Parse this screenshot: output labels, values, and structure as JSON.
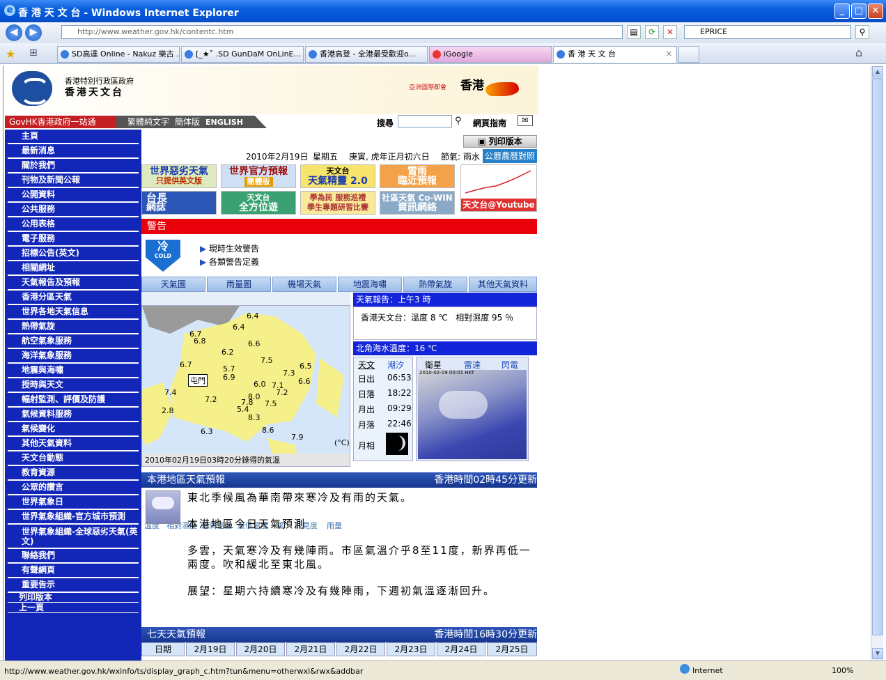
{
  "window": {
    "title": "香 港 天 文 台 - Windows Internet Explorer",
    "btn_min": "_",
    "btn_max": "□",
    "btn_close": "✕"
  },
  "address": {
    "url": "http://www.weather.gov.hk/contentc.htm",
    "search": "EPRICE"
  },
  "tabs": [
    {
      "label": "SD高達 Online - Nakuz 樂古 ..."
    },
    {
      "label": "[_★˚ .SD GunDaM OnLinE..."
    },
    {
      "label": "香港高登 - 全港最受歡迎o..."
    },
    {
      "label": "iGoogle"
    },
    {
      "label": "香 港 天 文 台"
    }
  ],
  "header": {
    "gov": "香港特別行政區政府",
    "obs": "香港天文台",
    "asia": "亞洲國際都會",
    "hk": "香港"
  },
  "govbar": {
    "govhk": "GovHK香港政府一站通",
    "trad": "繁體純文字",
    "simp": "簡体版",
    "eng": "ENGLISH",
    "search_label": "搜尋",
    "guide": "網頁指南"
  },
  "leftnav": [
    "主頁",
    "最新消息",
    "關於我們",
    "刊物及新聞公報",
    "公開資料",
    "公共服務",
    "公用表格",
    "電子服務",
    "招標公告(英文)",
    "相關網址",
    "天氣報告及預報",
    "香港分區天氣",
    "世界各地天氣信息",
    "熱帶氣旋",
    "航空氣象服務",
    "海洋氣象服務",
    "地震與海嘯",
    "授時與天文",
    "輻射監測、評價及防護",
    "氣候資料服務",
    "氣候變化",
    "其他天氣資料",
    "天文台動態",
    "教育資源",
    "公眾的讚言",
    "世界氣象日",
    "世界氣象組織-官方城市預測",
    "世界氣象組織-全球惡劣天氣(英文)",
    "聯絡我們",
    "有聲網頁",
    "重要告示",
    "列印版本",
    "上一頁"
  ],
  "dateline": {
    "date": "2010年2月19日",
    "weekday": "星期五",
    "lunar": "庚寅, 虎年正月初六日",
    "solar": "節氣: 雨水",
    "calendar": "公曆農曆對照",
    "print": "列印版本"
  },
  "banners": [
    "世界惡劣天氣",
    "只提供英文版",
    "世界官方預報",
    "簡體版",
    "天文台",
    "天氣精靈 2.0",
    "雷雨",
    "臨近預報",
    "台長",
    "網誌",
    "天文台",
    "全方位遊",
    "學為民 服務巡禮",
    "學生專題研習比賽",
    "社區天氣 Co-WIN",
    "資訊網絡",
    "天文台@Youtube"
  ],
  "warning": {
    "title": "警告",
    "cold": "冷",
    "cold_en": "COLD",
    "link1": "現時生效警告",
    "link2": "各類警告定義"
  },
  "weather_tabs": [
    "天氣圖",
    "雨量圖",
    "機場天氣",
    "地震海嘯",
    "熱帶氣旋",
    "其他天氣資料"
  ],
  "sub_tabs": [
    "溫度",
    "相對濕度",
    "最高溫度",
    "最低溫度",
    "風",
    "能見度",
    "雨量"
  ],
  "map": {
    "temps": [
      "6.4",
      "6.4",
      "6.7",
      "6.8",
      "6.6",
      "6.2",
      "7.5",
      "5.7",
      "6.5",
      "6.9",
      "6.7",
      "7.3",
      "6.0",
      "7.1",
      "6.6",
      "7.2",
      "7.4",
      "7.2",
      "8.0",
      "7.8",
      "7.5",
      "5.4",
      "2.8",
      "8.3",
      "6.3",
      "8.6",
      "7.9"
    ],
    "label": "屯門",
    "unit": "(°C)",
    "caption": "2010年02月19日03時20分錄得的氣溫"
  },
  "report": {
    "title": "天氣報告：上午3 時",
    "station": "香港天文台：",
    "temp": "溫度 8 ℃",
    "rh": "相對濕度 95 ％",
    "sea": "北角海水溫度：16 ℃"
  },
  "astro": {
    "tab1": "天文",
    "tab2": "潮汐",
    "rows": [
      [
        "日出",
        "06:53"
      ],
      [
        "日落",
        "18:22"
      ],
      [
        "月出",
        "09:29"
      ],
      [
        "月落",
        "22:46"
      ],
      [
        "月相",
        ""
      ]
    ]
  },
  "sat": {
    "tabs": [
      "衛星",
      "雷達",
      "閃電"
    ],
    "stamp": "2010-02-19 00:01 HKT"
  },
  "local": {
    "title": "本港地區天氣預報",
    "updated": "香港時間02時45分更新",
    "p1": "東北季候風為華南帶來寒冷及有雨的天氣。",
    "p2": "本港地區今日天氣預測",
    "p3": "多雲，天氣寒冷及有幾陣雨。市區氣溫介乎8至11度，新界再低一兩度。吹和緩北至東北風。",
    "p4": "展望：星期六持續寒冷及有幾陣雨，下週初氣溫逐漸回升。"
  },
  "seven": {
    "title": "七天天氣預報",
    "updated": "香港時間16時30分更新",
    "days": [
      "日期",
      "2月19日",
      "2月20日",
      "2月21日",
      "2月22日",
      "2月23日",
      "2月24日",
      "2月25日"
    ]
  },
  "status": {
    "url": "http://www.weather.gov.hk/wxinfo/ts/display_graph_c.htm?tun&menu=otherwxi&rwx&addbar",
    "zone": "Internet",
    "zoom": "100%"
  },
  "colors": {
    "nav": "#1226b8",
    "warn": "#e8000b",
    "report": "#1424d8"
  }
}
